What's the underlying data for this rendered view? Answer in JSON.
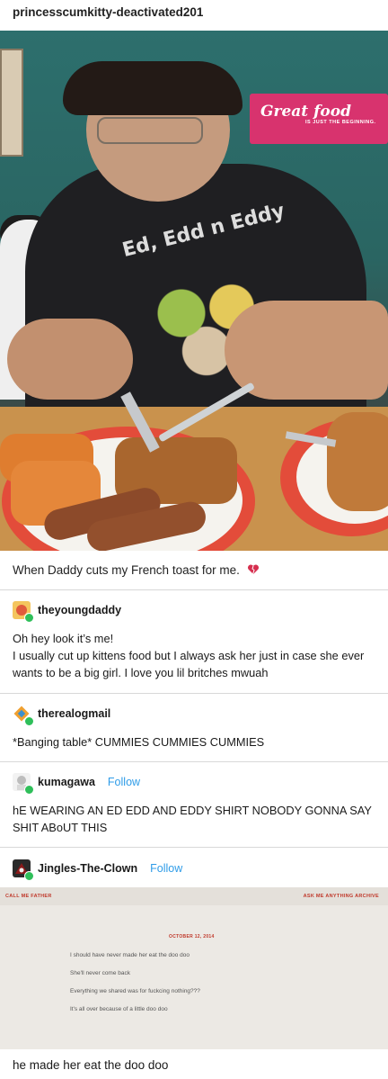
{
  "post": {
    "author": "princesscumkitty-deactivated201",
    "photo": {
      "sign_title": "Great food",
      "sign_subtitle": "IS JUST THE BEGINNING.",
      "shirt_text": "Ed, Edd n Eddy"
    },
    "caption": "When Daddy cuts my French toast for me."
  },
  "reblogs": [
    {
      "username": "theyoungdaddy",
      "avatar_color": "#e05a3c",
      "lines": [
        "Oh hey look it’s me!",
        "I usually cut up kittens food but I always ask her just in case she ever wants to be a big girl. I love you lil britches mwuah"
      ]
    },
    {
      "username": "therealogmail",
      "avatar_color": "#f0a030",
      "lines": [
        "*Banging table* CUMMIES CUMMIES CUMMIES"
      ]
    },
    {
      "username": "kumagawa",
      "follow_label": "Follow",
      "avatar_color": "#cccccc",
      "lines": [
        "hE WEARING AN ED EDD AND EDDY SHIRT NOBODY GONNA SAY SHIT ABoUT THIS"
      ]
    },
    {
      "username": "Jingles-The-Clown",
      "follow_label": "Follow",
      "avatar_color": "#8a1a1a",
      "embedded": {
        "left_nav": "CALL ME FATHER",
        "right_nav": "ASK ME ANYTHING    ARCHIVE",
        "date": "OCTOBER 12, 2014",
        "lines": [
          "I should have never made her eat the doo doo",
          "She'll never come back",
          "Everything we shared was for fuckcing nothing???",
          "It's all over because of a little doo doo"
        ]
      },
      "lines": [
        "he made her eat the doo doo"
      ]
    }
  ],
  "colors": {
    "follow": "#2f9ce8",
    "badge": "#2fbf5a"
  }
}
